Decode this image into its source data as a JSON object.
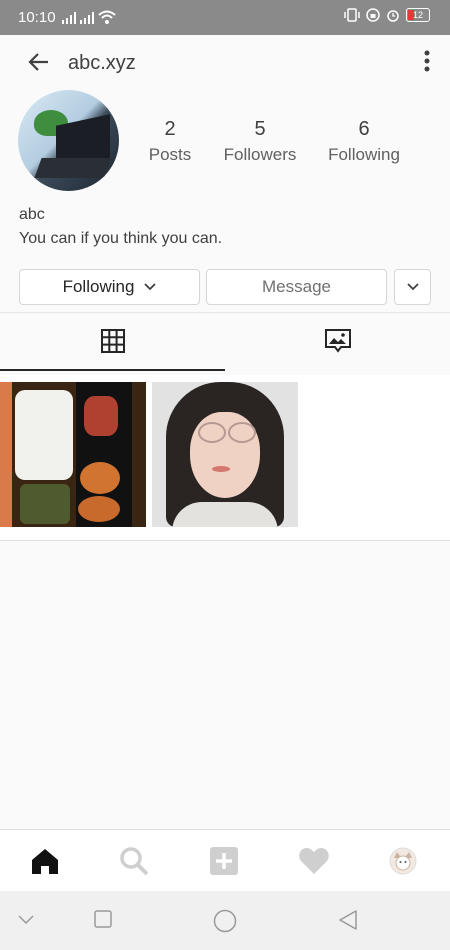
{
  "status_bar": {
    "time": "10:10",
    "battery": "12"
  },
  "header": {
    "username": "abc.xyz"
  },
  "stats": [
    {
      "count": "2",
      "label": "Posts"
    },
    {
      "count": "5",
      "label": "Followers"
    },
    {
      "count": "6",
      "label": "Following"
    }
  ],
  "profile": {
    "name": "abc",
    "bio": "You can if you think you can."
  },
  "buttons": {
    "following": "Following",
    "message": "Message"
  },
  "tabs": {
    "active": "grid"
  },
  "icons": [
    "back-arrow-icon",
    "more-vert-icon",
    "grid-icon",
    "tagged-icon",
    "home-icon",
    "search-icon",
    "add-icon",
    "heart-icon",
    "profile-icon"
  ],
  "colors": {
    "text": "#262626",
    "statusbar": "#8a8a8a",
    "nav_inactive": "#cfcfcf"
  }
}
